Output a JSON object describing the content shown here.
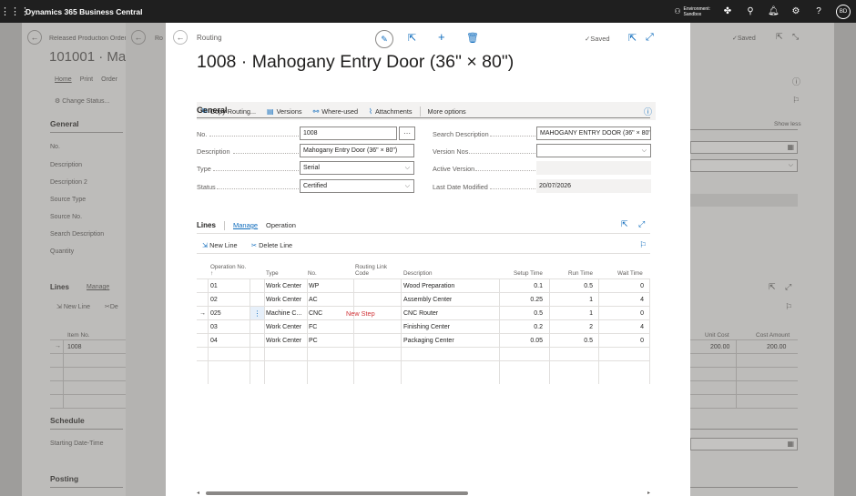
{
  "topbar": {
    "app_title": "Dynamics 365 Business Central",
    "env_label": "Environment:",
    "env_value": "Sandbox",
    "user_initials": "BD"
  },
  "background": {
    "breadcrumb": "Released Production Order",
    "breadcrumb2": "Ro",
    "page_title": "101001 · Mah",
    "tabs": [
      "Home",
      "Print",
      "Order"
    ],
    "change_status": "Change Status...",
    "general_heading": "General",
    "fields": [
      "No.",
      "Description",
      "Description 2",
      "Source Type",
      "Source No.",
      "Search Description",
      "Quantity"
    ],
    "lines_heading": "Lines",
    "lines_manage": "Manage",
    "new_line": "New Line",
    "delete_short": "De",
    "item_no_header": "Item No.",
    "item_no_value": "1008",
    "schedule_heading": "Schedule",
    "starting_date_time": "Starting Date-Time",
    "posting_heading": "Posting",
    "saved": "Saved",
    "show_less": "Show less",
    "unit_cost_header": "Unit Cost",
    "cost_amount_header": "Cost Amount",
    "unit_cost_value": "200.00",
    "cost_amount_value": "200.00"
  },
  "dialog": {
    "caption": "Routing",
    "title": "1008 · Mahogany Entry Door (36\" × 80\")",
    "saved": "Saved",
    "actions": [
      "Copy Routing...",
      "Versions",
      "Where-used",
      "Attachments",
      "More options"
    ],
    "general_heading": "General",
    "fields": {
      "no_label": "No.",
      "no_value": "1008",
      "description_label": "Description",
      "description_value": "Mahogany Entry Door (36\" × 80\")",
      "type_label": "Type",
      "type_value": "Serial",
      "status_label": "Status",
      "status_value": "Certified",
      "search_desc_label": "Search Description",
      "search_desc_value": "MAHOGANY ENTRY DOOR (36\" × 80\")",
      "version_nos_label": "Version Nos.",
      "version_nos_value": "",
      "active_version_label": "Active Version",
      "active_version_value": "",
      "last_modified_label": "Last Date Modified",
      "last_modified_value": "20/07/2026"
    },
    "lines": {
      "heading": "Lines",
      "tab_manage": "Manage",
      "tab_operation": "Operation",
      "new_line": "New Line",
      "delete_line": "Delete Line",
      "columns": [
        "Operation No.",
        "Type",
        "No.",
        "Routing Link Code",
        "Description",
        "Setup Time",
        "Run Time",
        "Wait Time"
      ],
      "rows": [
        {
          "op": "01",
          "type": "Work Center",
          "no": "WP",
          "link": "",
          "desc": "Wood Preparation",
          "setup": "0.1",
          "run": "0.5",
          "wait": "0"
        },
        {
          "op": "02",
          "type": "Work Center",
          "no": "AC",
          "link": "",
          "desc": "Assembly Center",
          "setup": "0.25",
          "run": "1",
          "wait": "4"
        },
        {
          "op": "025",
          "type": "Machine C...",
          "no": "CNC",
          "link": "",
          "desc": "CNC Router",
          "setup": "0.5",
          "run": "1",
          "wait": "0"
        },
        {
          "op": "03",
          "type": "Work Center",
          "no": "FC",
          "link": "",
          "desc": "Finishing Center",
          "setup": "0.2",
          "run": "2",
          "wait": "4"
        },
        {
          "op": "04",
          "type": "Work Center",
          "no": "PC",
          "link": "",
          "desc": "Packaging Center",
          "setup": "0.05",
          "run": "0.5",
          "wait": "0"
        }
      ],
      "annotation": "New Step"
    }
  }
}
